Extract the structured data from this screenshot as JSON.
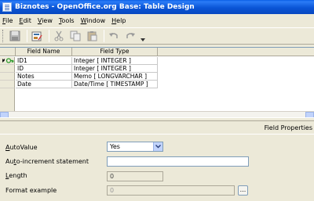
{
  "window": {
    "title": "Biznotes - OpenOffice.org Base: Table Design"
  },
  "menu": [
    {
      "label": "File",
      "key": "F",
      "rest": "ile"
    },
    {
      "label": "Edit",
      "key": "E",
      "rest": "dit"
    },
    {
      "label": "View",
      "key": "V",
      "rest": "iew"
    },
    {
      "label": "Tools",
      "key": "T",
      "rest": "ools"
    },
    {
      "label": "Window",
      "key": "W",
      "rest": "indow"
    },
    {
      "label": "Help",
      "key": "H",
      "rest": "elp"
    }
  ],
  "toolbar": {
    "icons": [
      "save-icon",
      "edit-icon",
      "cut-icon",
      "copy-icon",
      "paste-icon",
      "undo-icon",
      "redo-icon"
    ]
  },
  "grid": {
    "columns": [
      "Field Name",
      "Field Type"
    ],
    "rows": [
      {
        "name": "ID1",
        "type": "Integer [ INTEGER ]",
        "primary_key": true
      },
      {
        "name": "ID",
        "type": "Integer [ INTEGER ]",
        "primary_key": false
      },
      {
        "name": "Notes",
        "type": "Memo [ LONGVARCHAR ]",
        "primary_key": false
      },
      {
        "name": "Date",
        "type": "Date/Time [ TIMESTAMP ]",
        "primary_key": false
      }
    ]
  },
  "properties": {
    "title": "Field Properties",
    "autovalue": {
      "label_key": "A",
      "label_rest": "utoValue",
      "value": "Yes"
    },
    "auto_increment": {
      "label_pre": "Au",
      "label_key": "t",
      "label_rest": "o-increment statement",
      "value": ""
    },
    "length": {
      "label_key": "L",
      "label_rest": "ength",
      "value": "0"
    },
    "format_example": {
      "label": "Format example",
      "value": "0",
      "button": "..."
    }
  },
  "colors": {
    "title_bar": "#0a5ee6",
    "chrome": "#ece9d8",
    "key_icon": "#2e9a2e"
  }
}
